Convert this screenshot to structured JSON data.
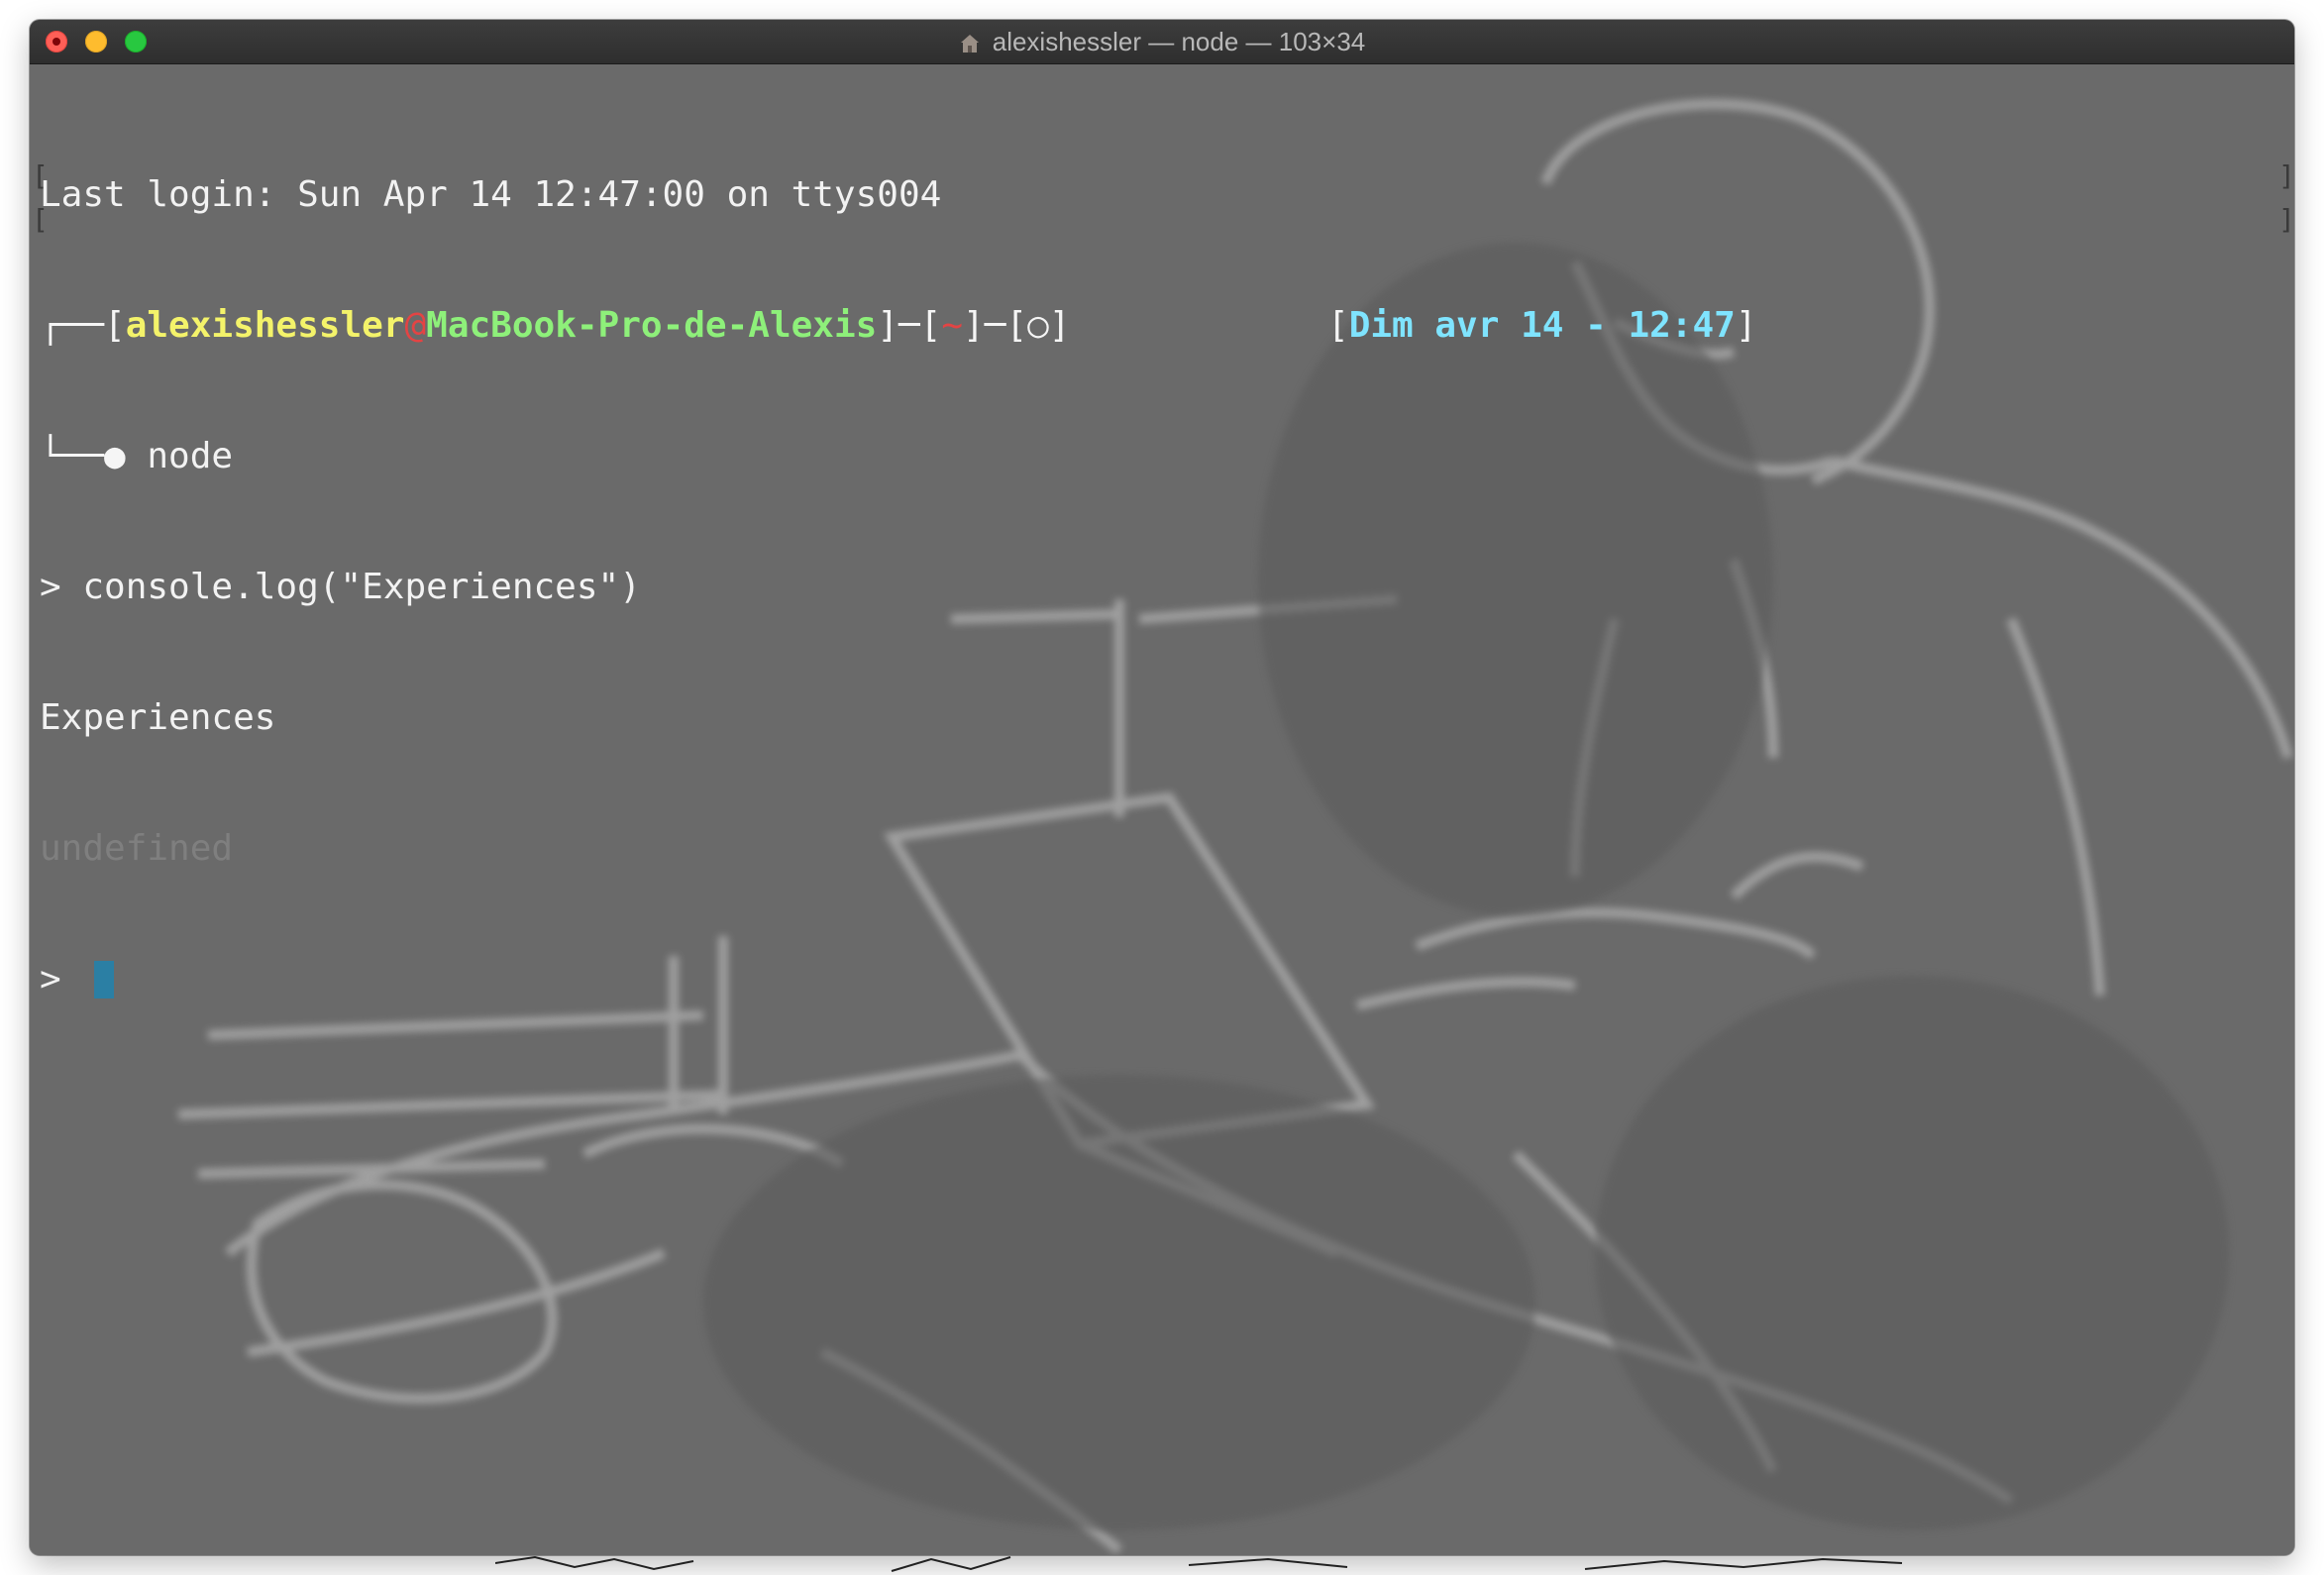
{
  "window": {
    "title": "alexishessler — node — 103×34"
  },
  "terminal": {
    "last_login": "Last login: Sun Apr 14 12:47:00 on ttys004",
    "prompt": {
      "box_open": "┌──[",
      "user": "alexishessler",
      "at": "@",
      "host": "MacBook-Pro-de-Alexis",
      "sep1": "]─[",
      "cwd": "~",
      "sep2": "]─[",
      "status": "○",
      "close": "]",
      "time_open": "[",
      "time": "Dim avr 14 - 12:47",
      "time_close": "]",
      "tree": "└──● ",
      "command": "node"
    },
    "repl_input": "> console.log(\"Experiences\")",
    "output": "Experiences",
    "return_value": "undefined",
    "repl_prompt": "> "
  },
  "colors": {
    "user": "#f4f36a",
    "host": "#8ef07a",
    "cwd": "#e34444",
    "time": "#7fe4ff",
    "cursor": "#2b7fa4",
    "background": "#6a6a6a"
  }
}
